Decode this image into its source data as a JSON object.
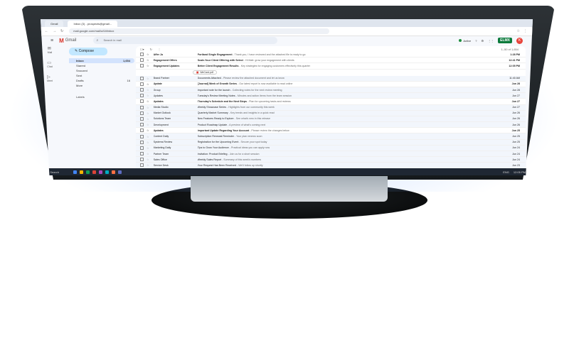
{
  "browser": {
    "tabs": [
      "Gmail",
      "Inbox (3) - prospects@gmail..."
    ],
    "url": "mail.google.com/mail/u/0/#inbox",
    "nav": [
      "←",
      "→",
      "↻"
    ],
    "toolbar_icons": [
      "☆",
      "⋮"
    ]
  },
  "gmail": {
    "menu_icon": "≡",
    "logo_letter": "M",
    "logo_text": "Gmail",
    "search_placeholder": "Search in mail",
    "status_label": "Active",
    "brand_badge": "ELMX",
    "avatar_initial": "K",
    "compose_label": "Compose",
    "rail": [
      "Mail",
      "Chat",
      "Meet"
    ],
    "folders": [
      {
        "label": "Inbox",
        "count": "1,654",
        "active": true
      },
      {
        "label": "Starred",
        "count": ""
      },
      {
        "label": "Snoozed",
        "count": ""
      },
      {
        "label": "Sent",
        "count": ""
      },
      {
        "label": "Drafts",
        "count": "16"
      },
      {
        "label": "More",
        "count": ""
      }
    ],
    "labels_title": "Labels",
    "list_toolbar": {
      "select": "☐▾",
      "refresh": "↻",
      "more": "⋮",
      "pagination": "1–50 of 1,654"
    },
    "attachment_label": "WeCard.pdf",
    "emails": [
      {
        "sender": "Affer Jo",
        "subject": "Portland Single Engagement",
        "snippet": " - Thank you, I have reviewed and the attached file is ready to go",
        "date": "1:28 PM",
        "unread": true
      },
      {
        "sender": "Engagement Offers",
        "subject": "Scale-Your Client Offering with Select",
        "snippet": " - Hi Matt: grow your engagement with clients",
        "date": "12:41 PM",
        "unread": true
      },
      {
        "sender": "Engagement Updates",
        "subject": "Better Client Engagement Results",
        "snippet": " - Key strategies for engaging customers effectively this quarter",
        "date": "12:05 PM",
        "unread": true
      },
      {
        "sender": "Brand Partner",
        "subject": "Documents Attached",
        "snippet": " - Please review the attached document and let us know",
        "date": "11:40 AM",
        "unread": false
      },
      {
        "sender": "Update",
        "subject": "[Journal] Week of Growth Series",
        "snippet": " - Our latest report is now available to read online",
        "date": "Jun 28",
        "unread": true
      },
      {
        "sender": "Group",
        "subject": "Important note for the launch",
        "snippet": " - Collecting notes for the next review meeting",
        "date": "Jun 28",
        "unread": false
      },
      {
        "sender": "Updates",
        "subject": "Tuesday's Review Meeting Notes",
        "snippet": " - Minutes and action items from the team session",
        "date": "Jun 27",
        "unread": false
      },
      {
        "sender": "Updates",
        "subject": "Thursday's Schedule and the Next Steps",
        "snippet": " - Plan for upcoming tasks and reviews",
        "date": "Jun 27",
        "unread": true
      },
      {
        "sender": "Media Studio",
        "subject": "Weekly Showcase Series",
        "snippet": " - Highlights from our community this week",
        "date": "Jun 27",
        "unread": false
      },
      {
        "sender": "Market Outlook",
        "subject": "Quarterly Market Summary",
        "snippet": " - Key trends and insights in a quick read",
        "date": "Jun 26",
        "unread": false
      },
      {
        "sender": "Solutions Team",
        "subject": "New Features Ready to Explore",
        "snippet": " - See what's new in this release",
        "date": "Jun 26",
        "unread": false
      },
      {
        "sender": "Development",
        "subject": "Product Roadmap Update",
        "snippet": " - A preview of what's coming next",
        "date": "Jun 26",
        "unread": false
      },
      {
        "sender": "Updates",
        "subject": "Important Update Regarding Your Account",
        "snippet": " - Please review the changes below",
        "date": "Jun 25",
        "unread": true
      },
      {
        "sender": "Content Daily",
        "subject": "Subscription Renewal Reminder",
        "snippet": " - Your plan renews soon",
        "date": "Jun 25",
        "unread": false
      },
      {
        "sender": "Systems Review",
        "subject": "Registration for the Upcoming Event",
        "snippet": " - Secure your spot today",
        "date": "Jun 25",
        "unread": false
      },
      {
        "sender": "Marketing Daily",
        "subject": "Tips to Grow Your Audience",
        "snippet": " - Practical ideas you can apply now",
        "date": "Jun 24",
        "unread": false
      },
      {
        "sender": "Partner Team",
        "subject": "Invitation: Product Briefing",
        "snippet": " - Join us for a short session",
        "date": "Jun 24",
        "unread": false
      },
      {
        "sender": "Sales Office",
        "subject": "Weekly Sales Report",
        "snippet": " - Summary of this week's numbers",
        "date": "Jun 24",
        "unread": false
      },
      {
        "sender": "Service Desk",
        "subject": "Your Request Has Been Received",
        "snippet": " - We'll follow up shortly",
        "date": "Jun 23",
        "unread": false
      },
      {
        "sender": "News Digest",
        "subject": "Top Stories This Week",
        "snippet": " - Catch up on what you missed",
        "date": "Jun 23",
        "unread": false
      }
    ]
  },
  "taskbar": {
    "search": "Search",
    "tray": [
      "ENG",
      "12:05 PM"
    ],
    "icon_colors": [
      "#4285f4",
      "#f4b400",
      "#0f9d58",
      "#db4437",
      "#ab47bc",
      "#00acc1",
      "#ff7043",
      "#5c6bc0"
    ]
  }
}
